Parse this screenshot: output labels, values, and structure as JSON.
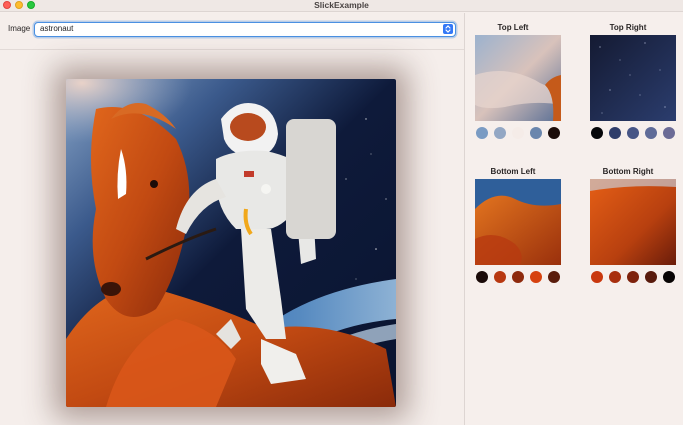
{
  "window": {
    "title": "SlickExample"
  },
  "toolbar": {
    "image_label": "Image",
    "select_value": "astronaut"
  },
  "quadrants": [
    {
      "title": "Top Left",
      "colors": [
        "#7a9bc3",
        "#93a7c4",
        "#f5ece8",
        "#6a86ad",
        "#1b0c09"
      ]
    },
    {
      "title": "Top Right",
      "colors": [
        "#050609",
        "#2f3d6a",
        "#465586",
        "#5f6b98",
        "#6b6b96"
      ]
    },
    {
      "title": "Bottom Left",
      "colors": [
        "#1a0a08",
        "#b83810",
        "#8e2a0d",
        "#d6420f",
        "#5a1c0c"
      ]
    },
    {
      "title": "Bottom Right",
      "colors": [
        "#c9380e",
        "#a82f0e",
        "#7e220c",
        "#581a0c",
        "#080404"
      ]
    }
  ]
}
